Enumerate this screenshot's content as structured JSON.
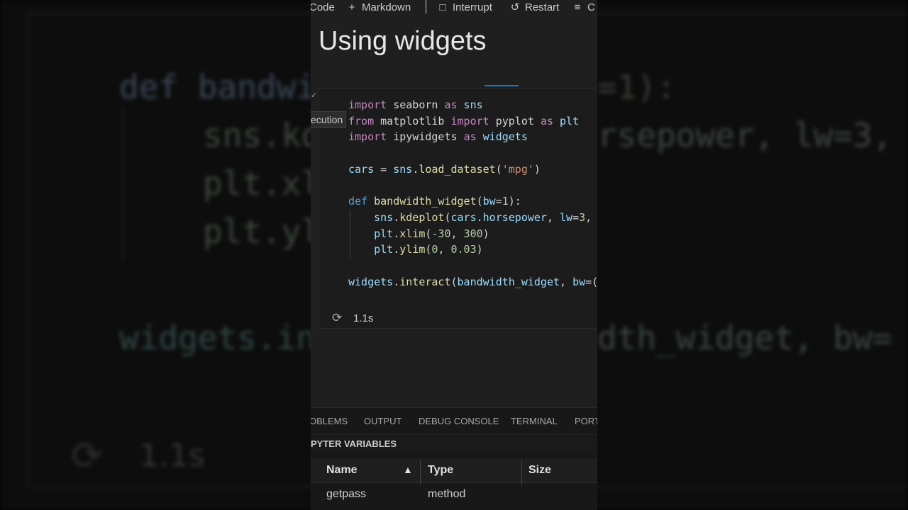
{
  "background_code": {
    "lines": [
      {
        "text": "def bandwi",
        "color": "#3a4656"
      },
      {
        "text": "    sns.kd",
        "color": "#3c463c"
      },
      {
        "text": "    plt.xl",
        "color": "#3c463c"
      },
      {
        "text": "    plt.yl",
        "color": "#3c463c"
      },
      {
        "text": "widgets.in",
        "color": "#2f4644"
      }
    ],
    "right_lines": [
      {
        "text": "=1):",
        "color": "#3a3a32"
      },
      {
        "text": "rsepower, lw=3,",
        "color": "#3c4540"
      },
      {
        "text": "dth_widget, bw=",
        "color": "#3a4640"
      }
    ],
    "time": "1.1s"
  },
  "toolbar": {
    "code_label": "Code",
    "markdown_label": "Markdown",
    "interrupt_label": "Interrupt",
    "restart_label": "Restart",
    "clear_label": "C",
    "icons": [
      "plus-icon",
      "stop-icon",
      "restart-icon",
      "clear-outputs-icon"
    ]
  },
  "markdown_cell": {
    "title": "Using widgets"
  },
  "code_cell": {
    "execution_tooltip": "ecution",
    "code_tokens": [
      [
        [
          "import",
          "kw"
        ],
        [
          " seaborn ",
          "p"
        ],
        [
          "as",
          "kw"
        ],
        [
          " sns",
          "v"
        ]
      ],
      [
        [
          "from",
          "kw"
        ],
        [
          " matplotlib ",
          "p"
        ],
        [
          "import",
          "kw"
        ],
        [
          " pyplot ",
          "p"
        ],
        [
          "as",
          "kw"
        ],
        [
          " plt",
          "v"
        ]
      ],
      [
        [
          "import",
          "kw"
        ],
        [
          " ipywidgets ",
          "p"
        ],
        [
          "as",
          "kw"
        ],
        [
          " widgets",
          "v"
        ]
      ],
      [],
      [
        [
          "cars",
          "v"
        ],
        [
          " = ",
          "p"
        ],
        [
          "sns",
          "v"
        ],
        [
          ".",
          "p"
        ],
        [
          "load_dataset",
          "f"
        ],
        [
          "(",
          "p"
        ],
        [
          "'mpg'",
          "s"
        ],
        [
          ")",
          "p"
        ]
      ],
      [],
      [
        [
          "def",
          "kw2"
        ],
        [
          " ",
          "p"
        ],
        [
          "bandwidth_widget",
          "f"
        ],
        [
          "(",
          "p"
        ],
        [
          "bw",
          "v"
        ],
        [
          "=",
          "p"
        ],
        [
          "1",
          "n"
        ],
        [
          "):",
          "p"
        ]
      ],
      [
        [
          "    ",
          "p"
        ],
        [
          "sns",
          "v"
        ],
        [
          ".",
          "p"
        ],
        [
          "kdeplot",
          "f"
        ],
        [
          "(",
          "p"
        ],
        [
          "cars",
          "v"
        ],
        [
          ".",
          "p"
        ],
        [
          "horsepower",
          "v"
        ],
        [
          ", ",
          "p"
        ],
        [
          "lw",
          "v"
        ],
        [
          "=",
          "p"
        ],
        [
          "3",
          "n"
        ],
        [
          ",",
          "p"
        ]
      ],
      [
        [
          "    ",
          "p"
        ],
        [
          "plt",
          "v"
        ],
        [
          ".",
          "p"
        ],
        [
          "xlim",
          "f"
        ],
        [
          "(",
          "p"
        ],
        [
          "-30",
          "n"
        ],
        [
          ", ",
          "p"
        ],
        [
          "300",
          "n"
        ],
        [
          ")",
          "p"
        ]
      ],
      [
        [
          "    ",
          "p"
        ],
        [
          "plt",
          "v"
        ],
        [
          ".",
          "p"
        ],
        [
          "ylim",
          "f"
        ],
        [
          "(",
          "p"
        ],
        [
          "0",
          "n"
        ],
        [
          ", ",
          "p"
        ],
        [
          "0.03",
          "n"
        ],
        [
          ")",
          "p"
        ]
      ],
      [],
      [
        [
          "widgets",
          "v"
        ],
        [
          ".",
          "p"
        ],
        [
          "interact",
          "f"
        ],
        [
          "(",
          "p"
        ],
        [
          "bandwidth_widget",
          "v"
        ],
        [
          ", ",
          "p"
        ],
        [
          "bw",
          "v"
        ],
        [
          "=(",
          "p"
        ]
      ]
    ],
    "status_time": "1.1s"
  },
  "panel_tabs": [
    "OBLEMS",
    "OUTPUT",
    "DEBUG CONSOLE",
    "TERMINAL",
    "PORT"
  ],
  "variables_panel": {
    "header": "PYTER VARIABLES",
    "columns": [
      "Name",
      "Type",
      "Size"
    ],
    "rows": [
      {
        "name": "getpass",
        "type": "method",
        "size": ""
      }
    ]
  },
  "colors": {
    "keyword": "#c586c0",
    "def_keyword": "#569cd6",
    "variable": "#9cdcfe",
    "function": "#dcdcaa",
    "string": "#ce9178",
    "number": "#b5cea8",
    "accent": "#0e7ad8"
  }
}
